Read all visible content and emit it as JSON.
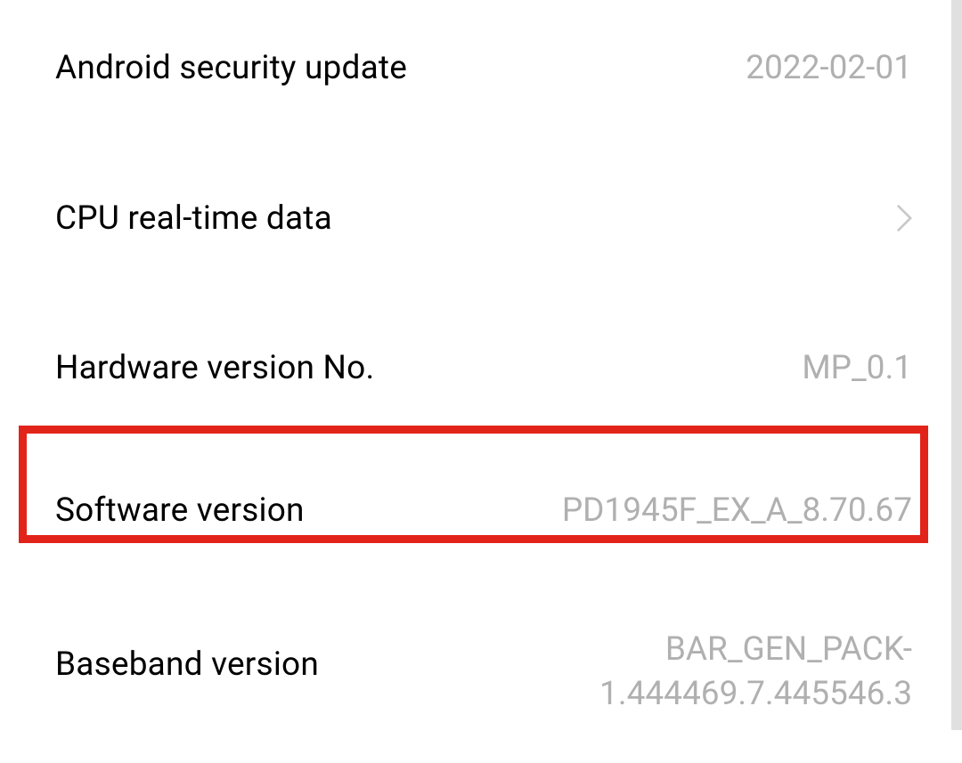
{
  "rows": {
    "security_update": {
      "label": "Android security update",
      "value": "2022-02-01"
    },
    "cpu_data": {
      "label": "CPU real-time data"
    },
    "hardware_version": {
      "label": "Hardware version No.",
      "value": "MP_0.1"
    },
    "software_version": {
      "label": "Software version",
      "value": "PD1945F_EX_A_8.70.67"
    },
    "baseband_version": {
      "label": "Baseband version",
      "value": "BAR_GEN_PACK-1.444469.7.445546.3"
    }
  }
}
